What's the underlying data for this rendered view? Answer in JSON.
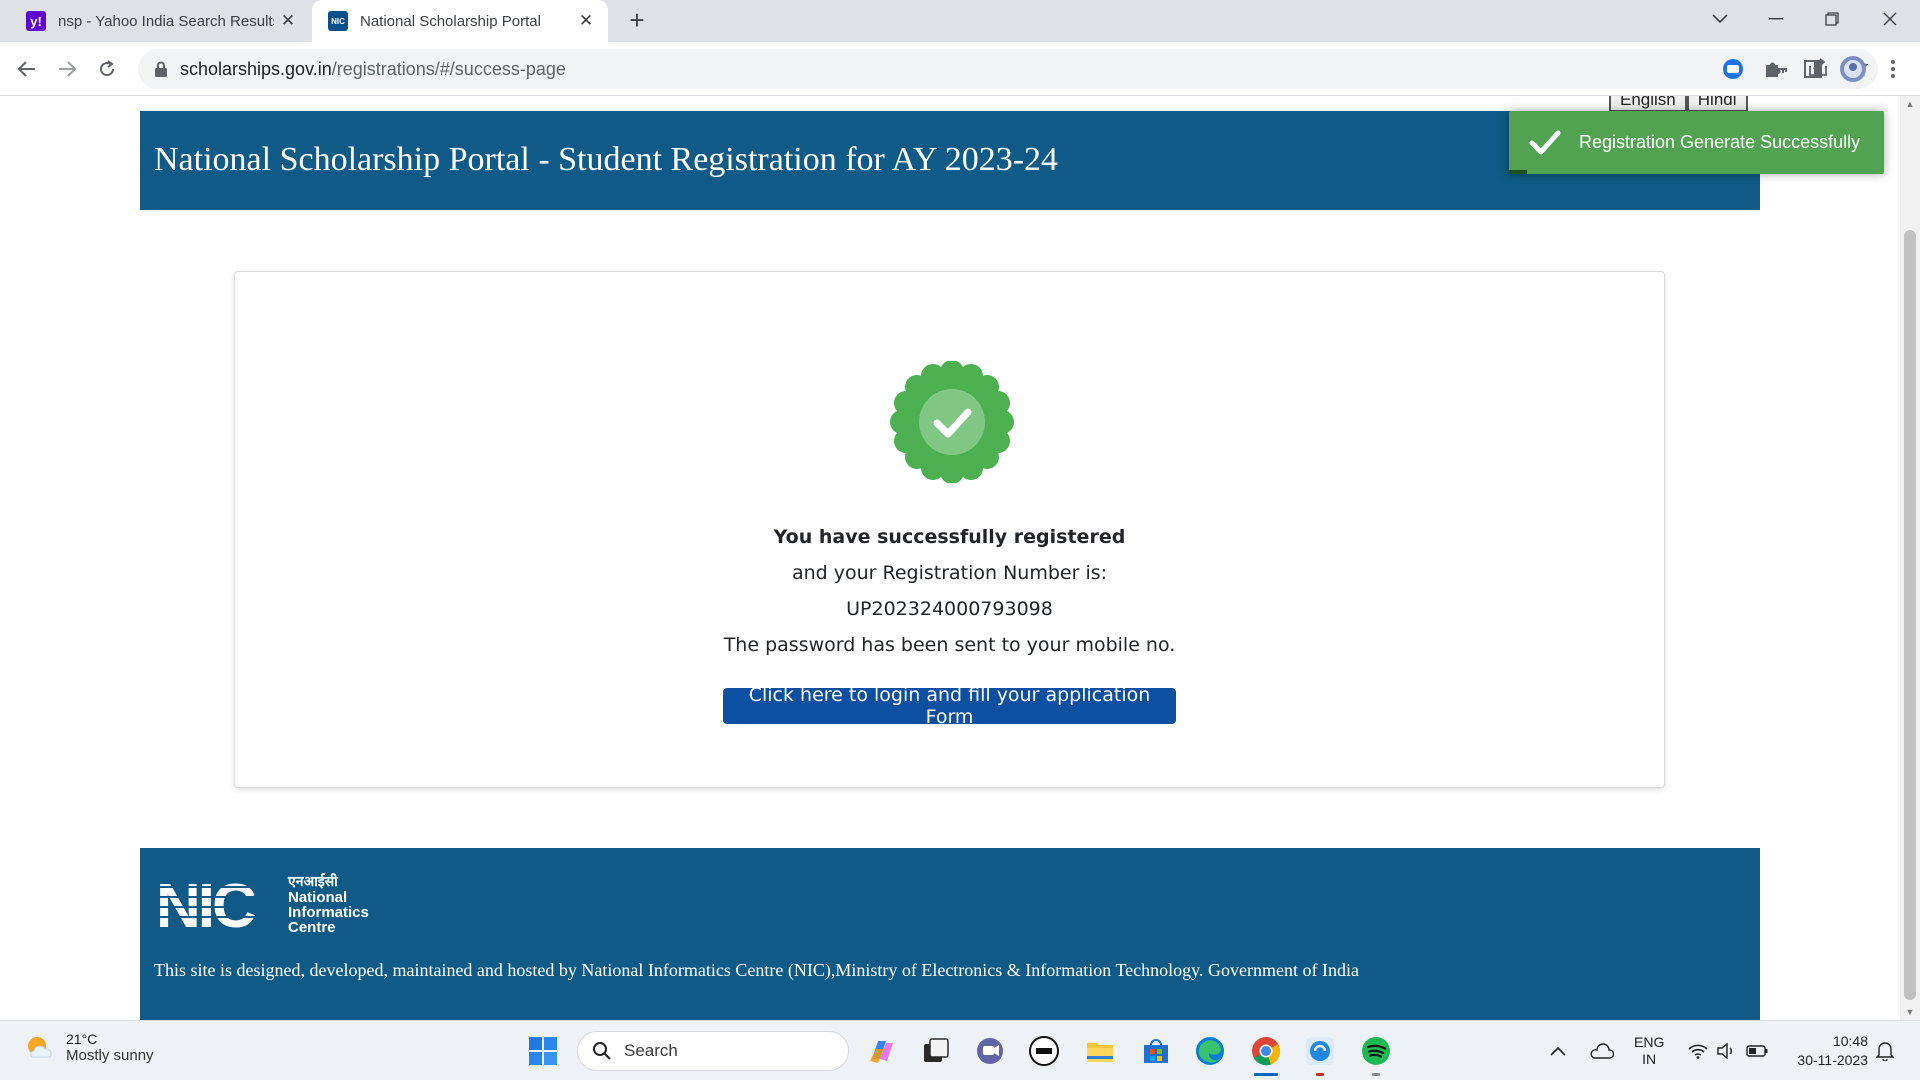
{
  "browser": {
    "tabs": [
      {
        "title": "nsp - Yahoo India Search Results",
        "favicon": "yahoo-icon",
        "active": false
      },
      {
        "title": "National Scholarship Portal",
        "favicon": "nic-icon",
        "active": true
      }
    ],
    "address": {
      "domain": "scholarships.gov.in",
      "path": "/registrations/#/success-page"
    },
    "favicon_text": {
      "yahoo": "y!",
      "nic": "NIC"
    }
  },
  "page": {
    "language_buttons": [
      "English",
      "Hindi"
    ],
    "header_title": "National Scholarship Portal - Student Registration for AY 2023-24",
    "toast": {
      "message": "Registration Generate Successfully",
      "color": "#51a351"
    },
    "success": {
      "heading": "You have successfully registered",
      "line2": "and your Registration Number is:",
      "registration_number": "UP202324000793098",
      "line4": "The password has been sent to your mobile no.",
      "cta_label": "Click here to login and fill your application Form"
    },
    "footer": {
      "logo_hindi": "एनआईसी",
      "logo_lines": [
        "National",
        "Informatics",
        "Centre"
      ],
      "logo_letters": "NIC",
      "text": "This site is designed, developed, maintained and hosted by National Informatics Centre (NIC),Ministry of Electronics & Information Technology. Government of India"
    },
    "colors": {
      "brand_blue": "#0f5a86",
      "button_blue": "#0d4fa0",
      "success_green": "#4caf50"
    }
  },
  "taskbar": {
    "weather": {
      "temp": "21°C",
      "desc": "Mostly sunny"
    },
    "search_placeholder": "Search",
    "lang": {
      "line1": "ENG",
      "line2": "IN"
    },
    "clock": {
      "time": "10:48",
      "date": "30-11-2023"
    }
  }
}
